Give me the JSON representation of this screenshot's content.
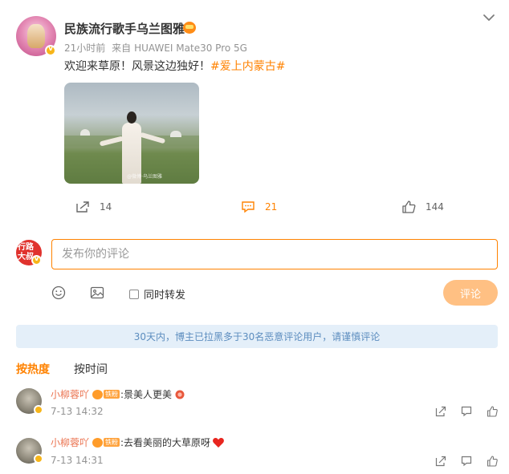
{
  "post": {
    "author": "民族流行歌手乌兰图雅",
    "time": "21小时前",
    "source_prefix": "来自",
    "device": "HUAWEI Mate30 Pro 5G",
    "text": "欢迎来草原！风景这边独好！",
    "hashtag": "#爱上内蒙古#",
    "photo_watermark": "@微博·乌兰图雅"
  },
  "actions": {
    "repost_count": "14",
    "comment_count": "21",
    "like_count": "144"
  },
  "composer": {
    "avatar_text": "行路 大叔",
    "placeholder": "发布你的评论",
    "repost_label": "同时转发",
    "submit_label": "评论"
  },
  "notice": "30天内，博主已拉黑多于30名恶意评论用户，请谨慎评论",
  "sort": {
    "hot": "按热度",
    "time": "按时间"
  },
  "comments": [
    {
      "user": "小柳蓉吖",
      "fan_badge": "铁粉",
      "text": ":景美人更美",
      "time": "7-13 14:32"
    },
    {
      "user": "小柳蓉吖",
      "fan_badge": "铁粉",
      "text": ":去看美丽的大草原呀",
      "time": "7-13 14:31"
    }
  ],
  "colors": {
    "accent": "#ff8200",
    "username": "#eb7350",
    "notice_bg": "#e4eff9",
    "notice_text": "#5c8dbf",
    "submit_bg": "#ffc083"
  }
}
